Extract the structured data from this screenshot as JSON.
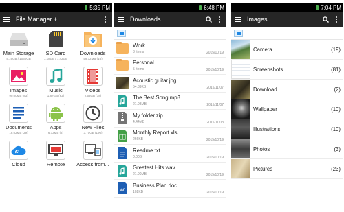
{
  "panel1": {
    "status_time": "5:35 PM",
    "title": "File Manager +",
    "items": [
      {
        "label": "Main Storage",
        "sub": "4.19GB / 1030GB",
        "icon": "hard-drive-icon"
      },
      {
        "label": "SD Card",
        "sub": "1.18GB / 7.42GB",
        "icon": "sd-card-icon"
      },
      {
        "label": "Downloads",
        "sub": "59.72MB (16)",
        "icon": "downloads-folder-icon"
      },
      {
        "label": "Images",
        "sub": "90.00MB (83)",
        "icon": "image-icon"
      },
      {
        "label": "Music",
        "sub": "1.87GB (62)",
        "icon": "music-note-icon"
      },
      {
        "label": "Videos",
        "sub": "2.53GB (18)",
        "icon": "video-icon"
      },
      {
        "label": "Documents",
        "sub": "18.02MB (29)",
        "icon": "document-icon"
      },
      {
        "label": "Apps",
        "sub": "6.73MB (2)",
        "icon": "android-icon"
      },
      {
        "label": "New Files",
        "sub": "3.70GB (196)",
        "icon": "clock-icon"
      },
      {
        "label": "Cloud",
        "sub": "",
        "icon": "cloud-icon"
      },
      {
        "label": "Remote",
        "sub": "",
        "icon": "remote-icon"
      },
      {
        "label": "Access from...",
        "sub": "",
        "icon": "computer-phone-icon"
      }
    ]
  },
  "panel2": {
    "status_time": "6:48 PM",
    "title": "Downloads",
    "files": [
      {
        "name": "Work",
        "sub": "3 items",
        "date": "2015/10/19",
        "type": "folder"
      },
      {
        "name": "Personal",
        "sub": "5 items",
        "date": "2015/10/19",
        "type": "folder"
      },
      {
        "name": "Acoustic guitar.jpg",
        "sub": "54.39KB",
        "date": "2015/11/07",
        "type": "image"
      },
      {
        "name": "The Best Song.mp3",
        "sub": "21.98MB",
        "date": "2015/11/07",
        "type": "audio"
      },
      {
        "name": "My folder.zip",
        "sub": "4.44MB",
        "date": "2015/11/03",
        "type": "zip"
      },
      {
        "name": "Monthly Report.xls",
        "sub": "266KB",
        "date": "2015/10/19",
        "type": "xls"
      },
      {
        "name": "Readme.txt",
        "sub": "0.00B",
        "date": "2015/10/19",
        "type": "txt"
      },
      {
        "name": "Greatest Hits.wav",
        "sub": "21.90MB",
        "date": "2015/10/19",
        "type": "audio"
      },
      {
        "name": "Business Plan.doc",
        "sub": "102KB",
        "date": "2015/10/19",
        "type": "doc"
      }
    ]
  },
  "panel3": {
    "status_time": "7:04 PM",
    "title": "Images",
    "albums": [
      {
        "name": "Camera",
        "count": "(19)",
        "thumb": "camera-thumb"
      },
      {
        "name": "Screenshots",
        "count": "(81)",
        "thumb": "screenshots-thumb"
      },
      {
        "name": "Download",
        "count": "(2)",
        "thumb": "download-thumb"
      },
      {
        "name": "Wallpaper",
        "count": "(10)",
        "thumb": "wallpaper-thumb"
      },
      {
        "name": "Illustrations",
        "count": "(10)",
        "thumb": "illustrations-thumb"
      },
      {
        "name": "Photos",
        "count": "(3)",
        "thumb": "photos-thumb"
      },
      {
        "name": "Pictures",
        "count": "(23)",
        "thumb": "pictures-thumb"
      }
    ]
  },
  "colors": {
    "actionbar": "#262626",
    "statusbar": "#000000",
    "accent": "#1e88e5",
    "folder": "#f6b35c"
  }
}
